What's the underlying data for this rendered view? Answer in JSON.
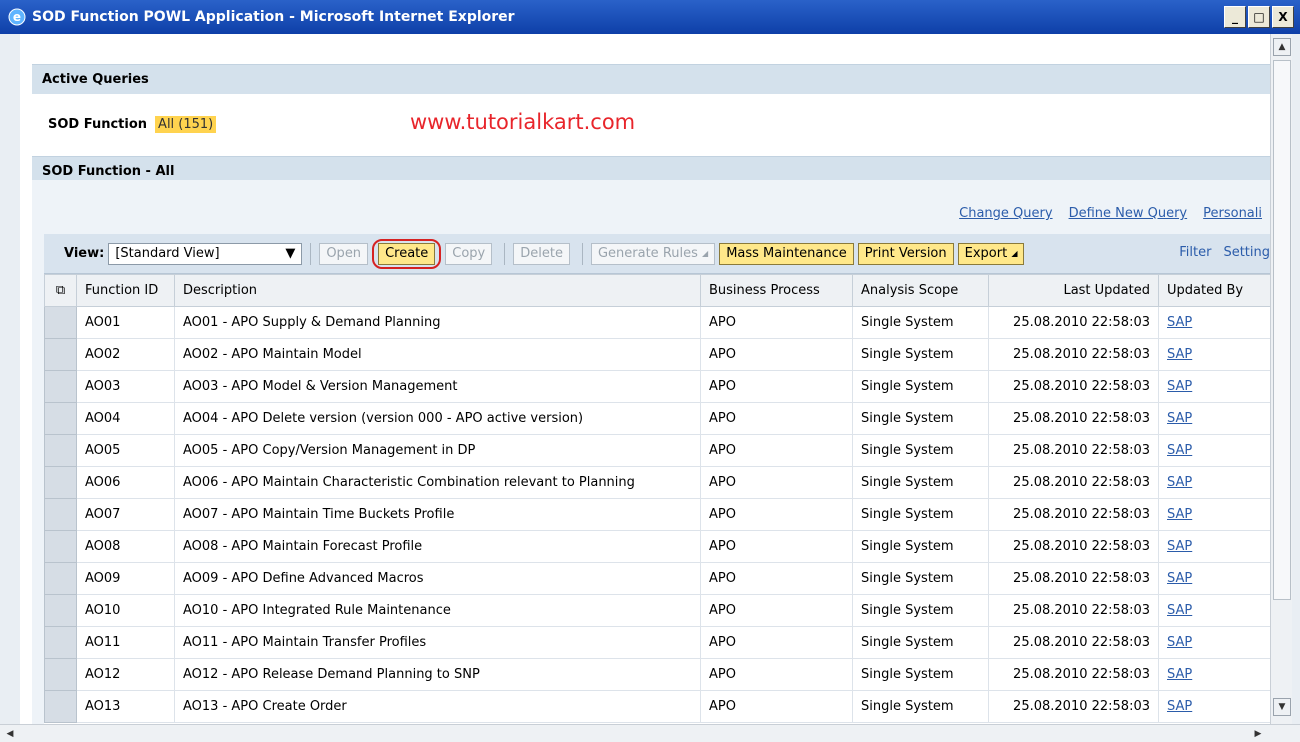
{
  "window": {
    "title": "SOD Function POWL Application - Microsoft Internet Explorer",
    "min_label": "_",
    "max_label": "□",
    "close_label": "X"
  },
  "active_queries": {
    "heading": "Active Queries",
    "query_label": "SOD Function",
    "query_all": "All (151)"
  },
  "watermark": "www.tutorialkart.com",
  "section": {
    "heading": "SOD Function - All"
  },
  "links": {
    "change_query": "Change Query",
    "define_new_query": "Define New Query",
    "personalize": "Personali"
  },
  "toolbar": {
    "view_label": "View:",
    "view_value": "[Standard View]",
    "open": "Open",
    "create": "Create",
    "copy": "Copy",
    "delete": "Delete",
    "generate_rules": "Generate Rules",
    "mass_maintenance": "Mass Maintenance",
    "print_version": "Print Version",
    "export": "Export",
    "filter": "Filter",
    "settings": "Setting"
  },
  "table": {
    "columns": [
      "Function ID",
      "Description",
      "Business Process",
      "Analysis Scope",
      "Last Updated",
      "Updated By"
    ],
    "rows": [
      [
        "AO01",
        "AO01 - APO Supply & Demand Planning",
        "APO",
        "Single System",
        "25.08.2010 22:58:03",
        "SAP"
      ],
      [
        "AO02",
        "AO02 - APO Maintain Model",
        "APO",
        "Single System",
        "25.08.2010 22:58:03",
        "SAP"
      ],
      [
        "AO03",
        "AO03 - APO Model & Version Management",
        "APO",
        "Single System",
        "25.08.2010 22:58:03",
        "SAP"
      ],
      [
        "AO04",
        "AO04 - APO Delete version (version 000 - APO active version)",
        "APO",
        "Single System",
        "25.08.2010 22:58:03",
        "SAP"
      ],
      [
        "AO05",
        "AO05 - APO Copy/Version Management in DP",
        "APO",
        "Single System",
        "25.08.2010 22:58:03",
        "SAP"
      ],
      [
        "AO06",
        "AO06 - APO Maintain Characteristic Combination relevant to Planning",
        "APO",
        "Single System",
        "25.08.2010 22:58:03",
        "SAP"
      ],
      [
        "AO07",
        "AO07 - APO Maintain Time Buckets Profile",
        "APO",
        "Single System",
        "25.08.2010 22:58:03",
        "SAP"
      ],
      [
        "AO08",
        "AO08 - APO Maintain Forecast Profile",
        "APO",
        "Single System",
        "25.08.2010 22:58:03",
        "SAP"
      ],
      [
        "AO09",
        "AO09 - APO Define Advanced Macros",
        "APO",
        "Single System",
        "25.08.2010 22:58:03",
        "SAP"
      ],
      [
        "AO10",
        "AO10 - APO Integrated Rule Maintenance",
        "APO",
        "Single System",
        "25.08.2010 22:58:03",
        "SAP"
      ],
      [
        "AO11",
        "AO11 - APO Maintain Transfer Profiles",
        "APO",
        "Single System",
        "25.08.2010 22:58:03",
        "SAP"
      ],
      [
        "AO12",
        "AO12 - APO Release Demand Planning to SNP",
        "APO",
        "Single System",
        "25.08.2010 22:58:03",
        "SAP"
      ],
      [
        "AO13",
        "AO13 - APO Create Order",
        "APO",
        "Single System",
        "25.08.2010 22:58:03",
        "SAP"
      ]
    ]
  },
  "colors": {
    "accent_link": "#2b5caa",
    "query_highlight": "#ffd34f",
    "watermark": "#e8252b",
    "active_button": "#ffe88a"
  }
}
